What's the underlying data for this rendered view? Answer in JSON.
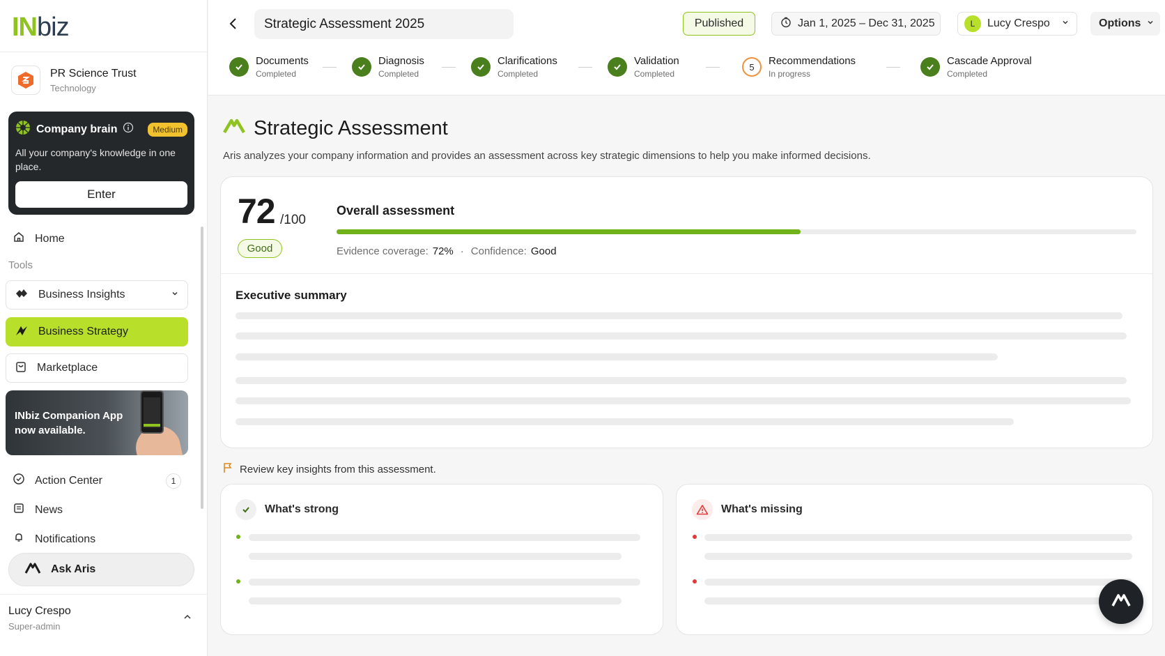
{
  "brand": {
    "logo_in": "IN",
    "logo_biz": "biz"
  },
  "organization": {
    "name": "PR Science Trust",
    "sector": "Technology"
  },
  "company_brain": {
    "title": "Company brain",
    "badge": "Medium",
    "description": "All your company's knowledge in one place.",
    "enter_label": "Enter"
  },
  "sidebar": {
    "home": "Home",
    "tools_label": "Tools",
    "tools": [
      {
        "label": "Business Insights",
        "icon": "insights-icon"
      },
      {
        "label": "Business Strategy",
        "icon": "strategy-icon"
      },
      {
        "label": "Marketplace",
        "icon": "bag-icon"
      }
    ],
    "promo": "INbiz Companion App now available.",
    "action_center": "Action Center",
    "action_center_count": "1",
    "news": "News",
    "notifications": "Notifications",
    "ask_aris": "Ask Aris"
  },
  "current_user": {
    "name": "Lucy Crespo",
    "role": "Super-admin",
    "initial": "L"
  },
  "topbar": {
    "title": "Strategic Assessment 2025",
    "status": "Published",
    "date_range": "Jan 1, 2025 – Dec 31, 2025",
    "user": "Lucy Crespo",
    "options": "Options"
  },
  "steps": [
    {
      "label": "Documents",
      "status": "Completed",
      "done": true
    },
    {
      "label": "Diagnosis",
      "status": "Completed",
      "done": true
    },
    {
      "label": "Clarifications",
      "status": "Completed",
      "done": true
    },
    {
      "label": "Validation",
      "status": "Completed",
      "done": true
    },
    {
      "label": "Recommendations",
      "status": "In progress",
      "done": false,
      "number": "5"
    },
    {
      "label": "Cascade Approval",
      "status": "Completed",
      "done": true
    }
  ],
  "assessment": {
    "title": "Strategic Assessment",
    "subtitle": "Aris analyzes your company information and provides an assessment across key strategic dimensions to help you make informed decisions.",
    "score": "72",
    "score_max": "/100",
    "rating": "Good",
    "overall_label": "Overall assessment",
    "overall_progress": 0.58,
    "evidence_label": "Evidence coverage:",
    "evidence_value": "72%",
    "separator": "·",
    "confidence_label": "Confidence:",
    "confidence_value": "Good",
    "executive_summary_title": "Executive summary",
    "review_prompt": "Review key insights from this assessment.",
    "strong_title": "What's strong",
    "missing_title": "What's missing"
  },
  "colors": {
    "accent": "#b8e02a",
    "brand_green": "#8fc31f",
    "progress": "#6fb21a",
    "step_done": "#4a7f1d",
    "step_active": "#f0913a",
    "badge_medium": "#f2c12e",
    "missing": "#e03a3a"
  }
}
